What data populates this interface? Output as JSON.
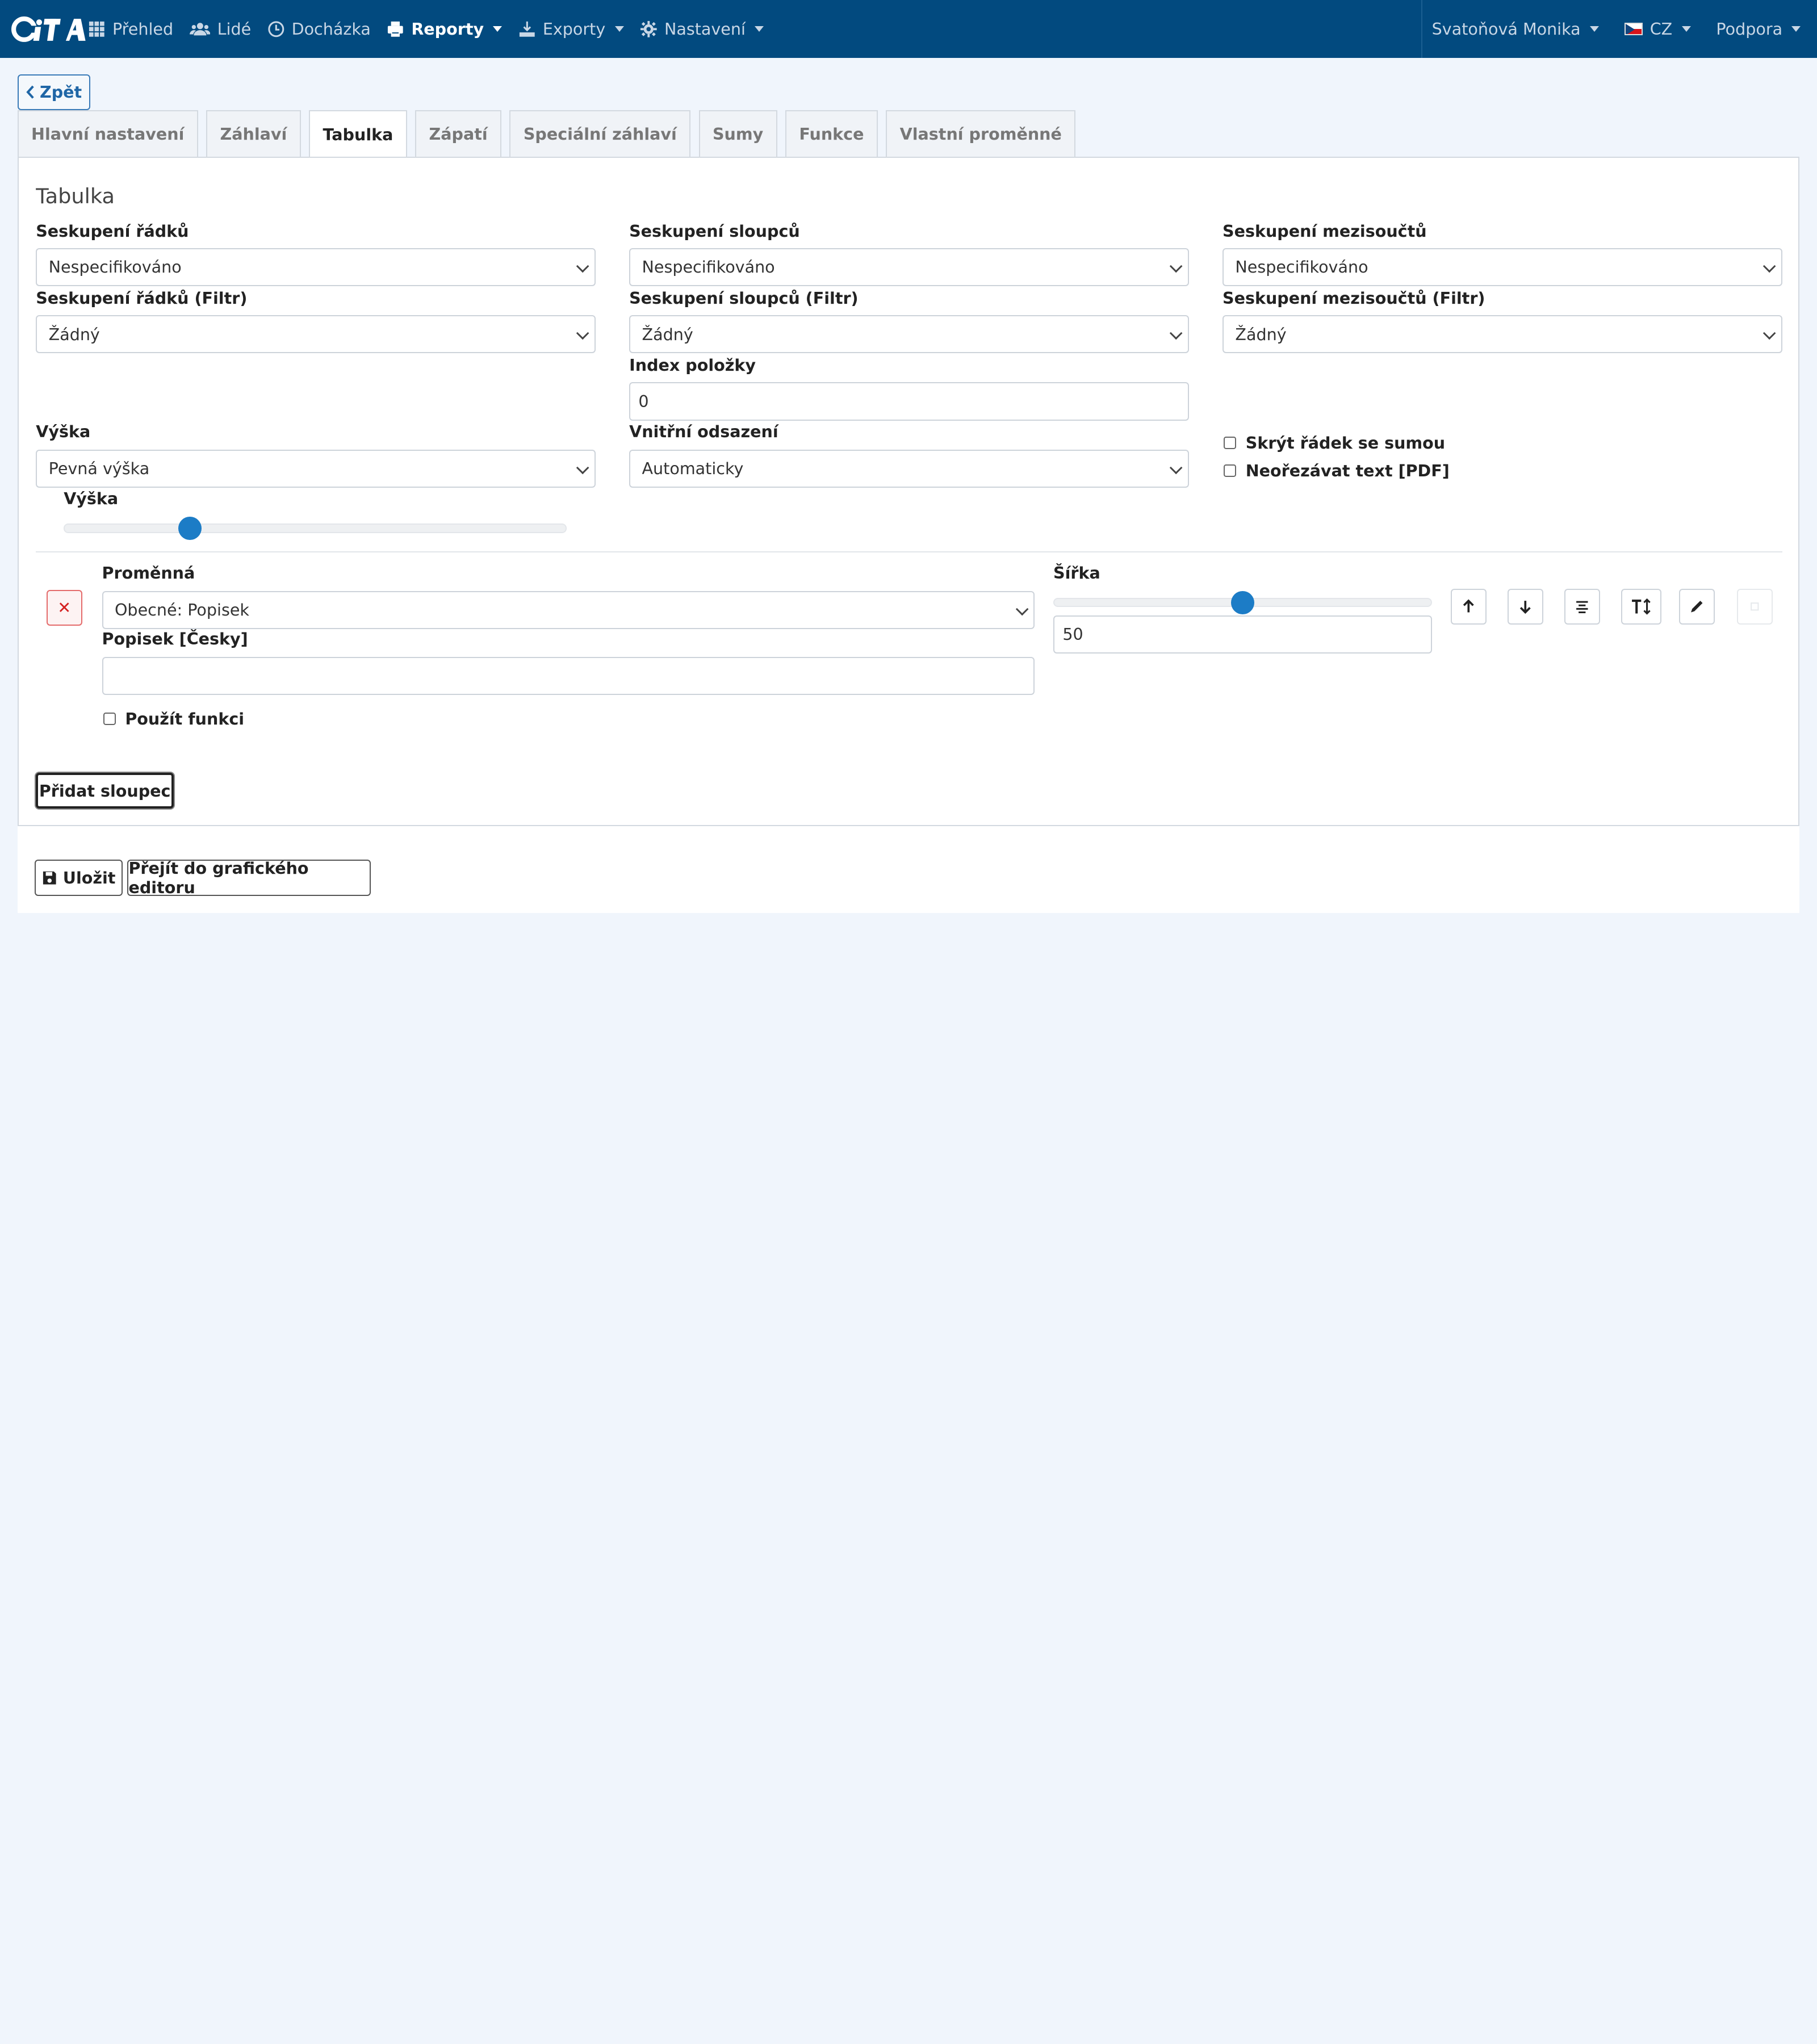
{
  "nav": {
    "logo": "CiTA",
    "items": [
      {
        "icon": "grid-icon",
        "label": "Přehled"
      },
      {
        "icon": "users-icon",
        "label": "Lidé"
      },
      {
        "icon": "clock-icon",
        "label": "Docházka"
      },
      {
        "icon": "printer-icon",
        "label": "Reporty"
      },
      {
        "icon": "export-icon",
        "label": "Exporty"
      },
      {
        "icon": "gear-icon",
        "label": "Nastavení"
      }
    ],
    "user": "Svatoňová Monika",
    "language": "CZ",
    "support": "Podpora"
  },
  "back_label": "Zpět",
  "tabs": [
    "Hlavní nastavení",
    "Záhlaví",
    "Tabulka",
    "Zápatí",
    "Speciální záhlaví",
    "Sumy",
    "Funkce",
    "Vlastní proměnné"
  ],
  "active_tab": "Tabulka",
  "panel": {
    "title": "Tabulka",
    "row_group_label": "Seskupení řádků",
    "row_group_value": "Nespecifikováno",
    "col_group_label": "Seskupení sloupců",
    "col_group_value": "Nespecifikováno",
    "subtotal_group_label": "Seskupení mezisoučtů",
    "subtotal_group_value": "Nespecifikováno",
    "row_filter_label": "Seskupení řádků (Filtr)",
    "row_filter_value": "Žádný",
    "col_filter_label": "Seskupení sloupců (Filtr)",
    "col_filter_value": "Žádný",
    "subtotal_filter_label": "Seskupení mezisoučtů (Filtr)",
    "subtotal_filter_value": "Žádný",
    "item_index_label": "Index položky",
    "item_index_value": "0",
    "height_label": "Výška",
    "height_value": "Pevná výška",
    "padding_label": "Vnitřní odsazení",
    "padding_value": "Automaticky",
    "hide_sum_row": "Skrýt řádek se sumou",
    "no_crop_text": "Neořezávat text [PDF]",
    "height_slider_label": "Výška",
    "height_slider_level": 0.25,
    "column": {
      "variable_label": "Proměnná",
      "variable_value": "Obecné: Popisek",
      "caption_label": "Popisek [Česky]",
      "caption_value": "",
      "use_function": "Použít funkci",
      "width_label": "Šířka",
      "width_value": "50",
      "width_slider_level": 0.5
    },
    "add_column": "Přidat sloupec"
  },
  "footer": {
    "save": "Uložit",
    "graphic_editor": "Přejít do grafického editoru"
  },
  "colors": {
    "navbar": "#024a7f",
    "accent": "#1c7cc6",
    "background": "#f0f5fc",
    "danger": "#d42121"
  }
}
